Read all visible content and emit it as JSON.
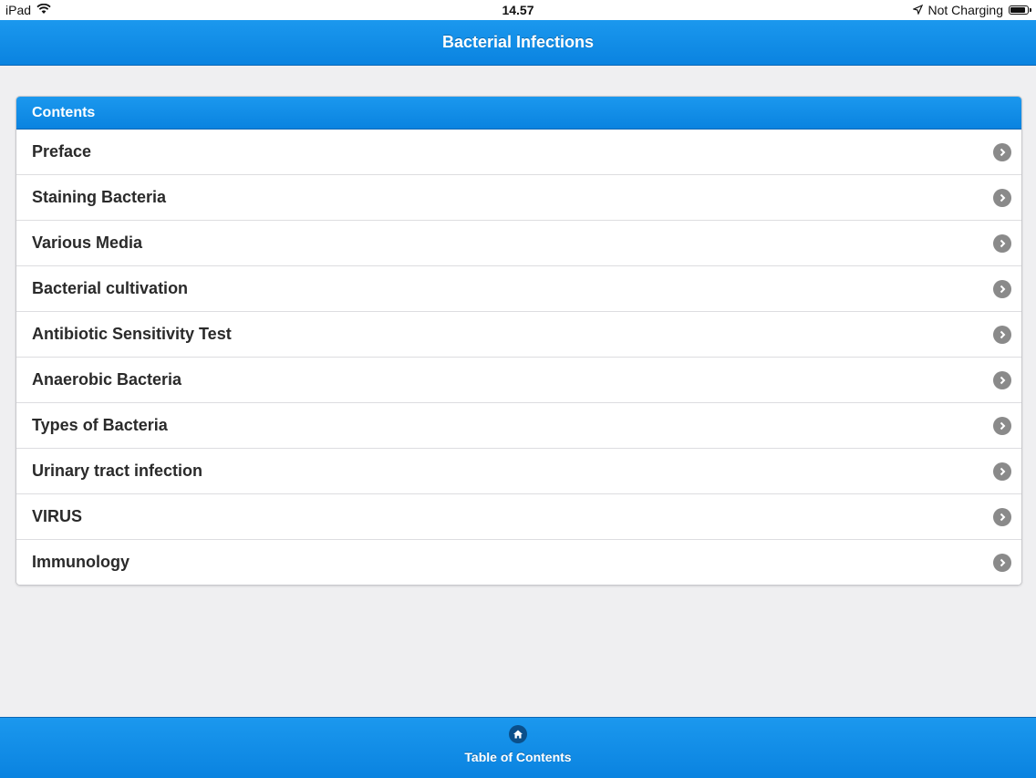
{
  "status_bar": {
    "device": "iPad",
    "time": "14.57",
    "charging": "Not Charging",
    "battery_level": 0.8
  },
  "nav": {
    "title": "Bacterial Infections"
  },
  "contents": {
    "header": "Contents",
    "items": [
      {
        "label": "Preface"
      },
      {
        "label": "Staining Bacteria"
      },
      {
        "label": "Various Media"
      },
      {
        "label": "Bacterial cultivation"
      },
      {
        "label": "Antibiotic Sensitivity Test"
      },
      {
        "label": "Anaerobic Bacteria"
      },
      {
        "label": "Types of Bacteria"
      },
      {
        "label": "Urinary tract infection"
      },
      {
        "label": "VIRUS"
      },
      {
        "label": "Immunology"
      }
    ]
  },
  "tab_bar": {
    "label": "Table of Contents",
    "icon": "home-icon"
  },
  "colors": {
    "accent": "#0a83e0",
    "chevron": "#8a8a8a",
    "background": "#efeff1"
  }
}
